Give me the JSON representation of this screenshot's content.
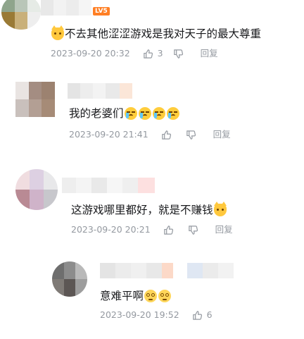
{
  "comments": [
    {
      "level_badge": "LV5",
      "text": "不去其他涩涩游戏是我对天子的最大尊重",
      "time": "2023-09-20 20:32",
      "likes": "3",
      "reply_label": "回复",
      "emoji_start": [
        "cat-face-icon"
      ],
      "emoji_end": []
    },
    {
      "text": "我的老婆们",
      "time": "2023-09-20 21:41",
      "likes": "",
      "reply_label": "回复",
      "emoji_end": [
        "crying-face-icon",
        "crying-face-icon",
        "crying-face-icon",
        "crying-face-icon"
      ]
    },
    {
      "text": "这游戏哪里都好，就是不赚钱",
      "time": "2023-09-20 20:21",
      "likes": "",
      "reply_label": "回复",
      "emoji_end": [
        "cat-face-icon"
      ]
    },
    {
      "text": "意难平啊",
      "time": "2023-09-20 19:52",
      "likes": "6",
      "emoji_end": [
        "blush-face-icon",
        "blush-face-icon"
      ]
    }
  ],
  "colors": {
    "text": "#18191c",
    "meta": "#9499a0",
    "badge": "#ff7f24"
  }
}
